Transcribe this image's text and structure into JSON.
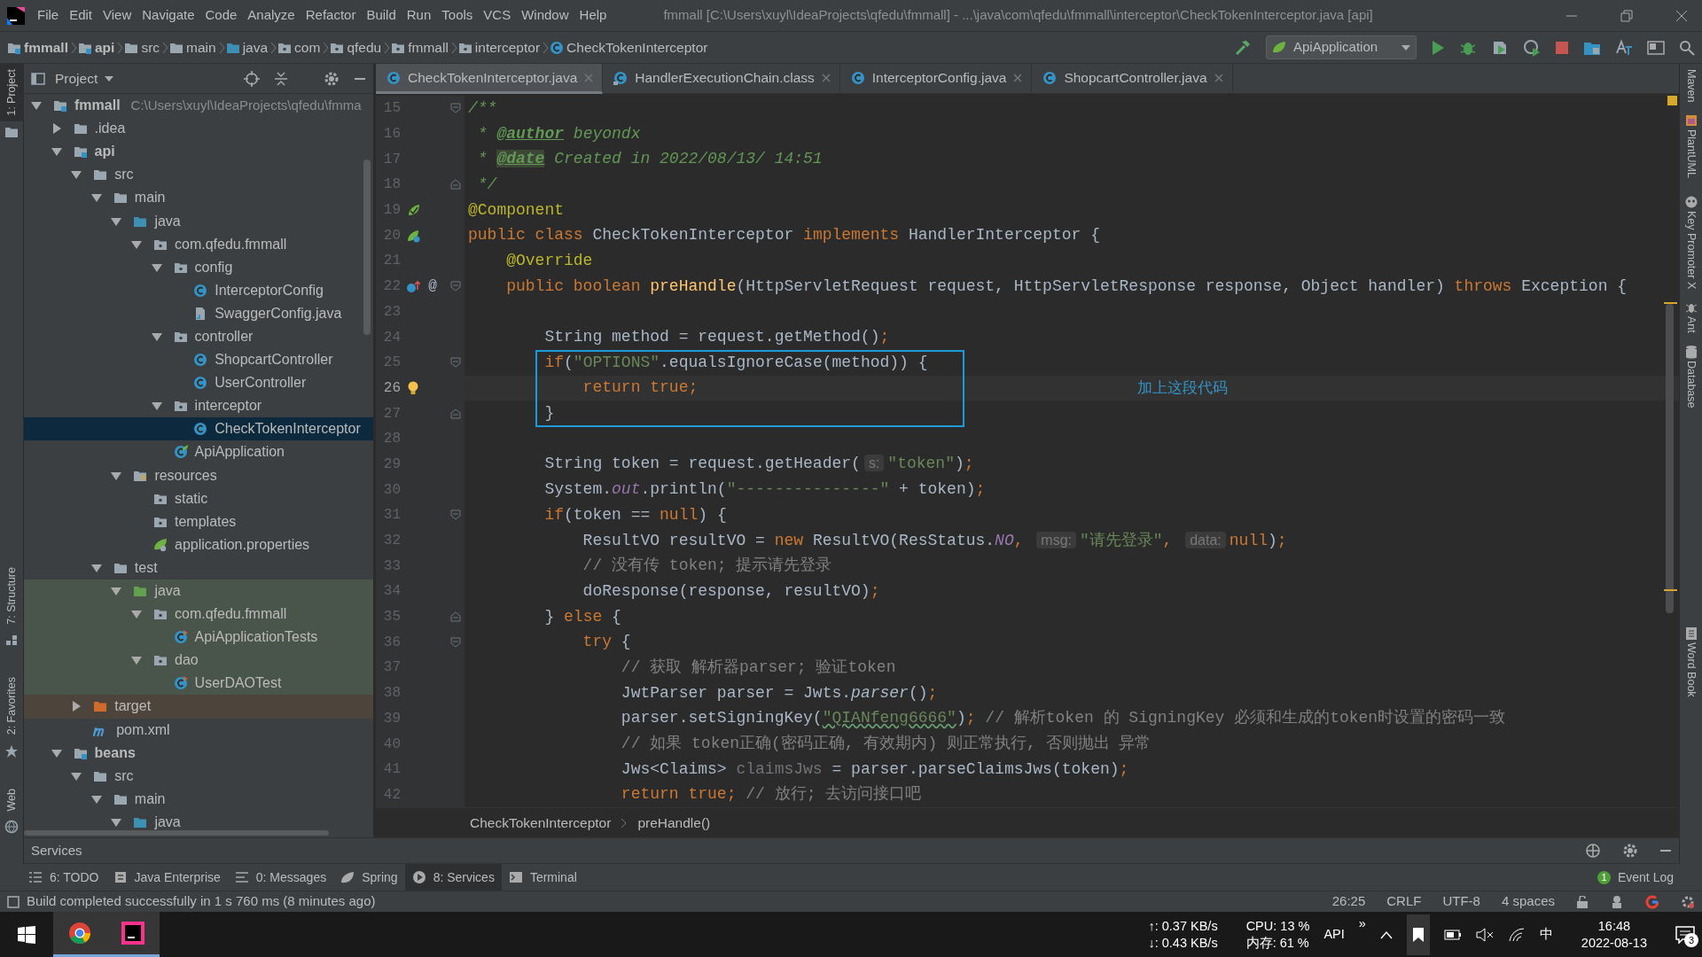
{
  "window": {
    "title": "fmmall [C:\\Users\\xuyl\\IdeaProjects\\qfedu\\fmmall] - ...\\java\\com\\qfedu\\fmmall\\interceptor\\CheckTokenInterceptor.java [api]"
  },
  "menu": [
    "File",
    "Edit",
    "View",
    "Navigate",
    "Code",
    "Analyze",
    "Refactor",
    "Build",
    "Run",
    "Tools",
    "VCS",
    "Window",
    "Help"
  ],
  "breadcrumbs": [
    {
      "label": "fmmall",
      "kind": "module"
    },
    {
      "label": "api",
      "kind": "module"
    },
    {
      "label": "src",
      "kind": "folder"
    },
    {
      "label": "main",
      "kind": "folder"
    },
    {
      "label": "java",
      "kind": "source-root"
    },
    {
      "label": "com",
      "kind": "package"
    },
    {
      "label": "qfedu",
      "kind": "package"
    },
    {
      "label": "fmmall",
      "kind": "package"
    },
    {
      "label": "interceptor",
      "kind": "package"
    },
    {
      "label": "CheckTokenInterceptor",
      "kind": "class"
    }
  ],
  "run_configuration": "ApiApplication",
  "left_strip": [
    {
      "label": "1: Project",
      "selected": true
    },
    {
      "label": "7: Structure",
      "selected": false
    },
    {
      "label": "2: Favorites",
      "selected": false
    },
    {
      "label": "Web",
      "selected": false
    }
  ],
  "right_strip": [
    "Maven",
    "PlantUML",
    "Key Promoter X",
    "Ant",
    "Database",
    "Word Book"
  ],
  "project_panel": {
    "title": "Project"
  },
  "project_tree": [
    {
      "label": "fmmall",
      "kind": "module",
      "path": "C:\\Users\\xuyl\\IdeaProjects\\qfedu\\fmma",
      "expanded": true,
      "selected": false,
      "children": [
        {
          "label": ".idea",
          "kind": "folder",
          "expanded": false,
          "selected": false
        },
        {
          "label": "api",
          "kind": "module",
          "expanded": true,
          "selected": false,
          "children": [
            {
              "label": "src",
              "kind": "folder",
              "expanded": true,
              "selected": false,
              "children": [
                {
                  "label": "main",
                  "kind": "folder",
                  "expanded": true,
                  "selected": false,
                  "children": [
                    {
                      "label": "java",
                      "kind": "source-root",
                      "expanded": true,
                      "selected": false,
                      "children": [
                        {
                          "label": "com.qfedu.fmmall",
                          "kind": "package",
                          "expanded": true,
                          "selected": false,
                          "children": [
                            {
                              "label": "config",
                              "kind": "package",
                              "expanded": true,
                              "selected": false,
                              "children": [
                                {
                                  "label": "InterceptorConfig",
                                  "kind": "class",
                                  "selected": false
                                },
                                {
                                  "label": "SwaggerConfig.java",
                                  "kind": "java-file",
                                  "selected": false
                                }
                              ]
                            },
                            {
                              "label": "controller",
                              "kind": "package",
                              "expanded": true,
                              "selected": false,
                              "children": [
                                {
                                  "label": "ShopcartController",
                                  "kind": "class",
                                  "selected": false
                                },
                                {
                                  "label": "UserController",
                                  "kind": "class",
                                  "selected": false
                                }
                              ]
                            },
                            {
                              "label": "interceptor",
                              "kind": "package",
                              "expanded": true,
                              "selected": false,
                              "children": [
                                {
                                  "label": "CheckTokenInterceptor",
                                  "kind": "class",
                                  "selected": true
                                }
                              ]
                            },
                            {
                              "label": "ApiApplication",
                              "kind": "spring-class",
                              "selected": false
                            }
                          ]
                        }
                      ]
                    },
                    {
                      "label": "resources",
                      "kind": "resources-root",
                      "expanded": true,
                      "selected": false,
                      "children": [
                        {
                          "label": "static",
                          "kind": "package",
                          "selected": false
                        },
                        {
                          "label": "templates",
                          "kind": "package",
                          "selected": false
                        },
                        {
                          "label": "application.properties",
                          "kind": "properties",
                          "selected": false
                        }
                      ]
                    }
                  ]
                },
                {
                  "label": "test",
                  "kind": "folder",
                  "expanded": true,
                  "selected": false,
                  "children": [
                    {
                      "label": "java",
                      "kind": "test-root",
                      "test_scope": true,
                      "expanded": true,
                      "selected": false,
                      "children": [
                        {
                          "label": "com.qfedu.fmmall",
                          "kind": "package",
                          "test_scope": true,
                          "expanded": true,
                          "selected": false,
                          "children": [
                            {
                              "label": "ApiApplicationTests",
                              "kind": "test-class",
                              "test_scope": true,
                              "selected": false
                            }
                          ]
                        },
                        {
                          "label": "dao",
                          "kind": "package",
                          "test_scope": true,
                          "expanded": true,
                          "selected": false,
                          "children": [
                            {
                              "label": "UserDAOTest",
                              "kind": "test-class",
                              "test_scope": true,
                              "selected": false
                            }
                          ]
                        }
                      ]
                    }
                  ]
                }
              ]
            },
            {
              "label": "target",
              "kind": "excluded-folder",
              "excluded": true,
              "expanded": false,
              "selected": false
            },
            {
              "label": "pom.xml",
              "kind": "maven",
              "selected": false
            }
          ]
        },
        {
          "label": "beans",
          "kind": "module",
          "expanded": true,
          "selected": false,
          "children": [
            {
              "label": "src",
              "kind": "folder",
              "expanded": true,
              "selected": false,
              "children": [
                {
                  "label": "main",
                  "kind": "folder",
                  "expanded": true,
                  "selected": false,
                  "children": [
                    {
                      "label": "java",
                      "kind": "source-root",
                      "expanded": true,
                      "selected": false
                    }
                  ]
                }
              ]
            }
          ]
        }
      ]
    }
  ],
  "editor_tabs": [
    {
      "label": "CheckTokenInterceptor.java",
      "kind": "class",
      "selected": true
    },
    {
      "label": "HandlerExecutionChain.class",
      "kind": "compiled-class",
      "selected": false
    },
    {
      "label": "InterceptorConfig.java",
      "kind": "class",
      "selected": false
    },
    {
      "label": "ShopcartController.java",
      "kind": "class",
      "selected": false
    }
  ],
  "code_lines": [
    {
      "number": "15",
      "fold": {
        "kind": "start"
      },
      "tokens": [
        {
          "kind": "doc",
          "text": "/**"
        }
      ]
    },
    {
      "number": "16",
      "tokens": [
        {
          "kind": "doc",
          "text": " * "
        },
        {
          "kind": "doc-tag",
          "text": "@author"
        },
        {
          "kind": "doc-italic",
          "text": " beyondx"
        }
      ]
    },
    {
      "number": "17",
      "tokens": [
        {
          "kind": "doc",
          "text": " * "
        },
        {
          "kind": "doc-tag-marked",
          "text": "@date"
        },
        {
          "kind": "doc-italic",
          "text": " Created in 2022/08/13/ 14:51"
        }
      ]
    },
    {
      "number": "18",
      "fold": {
        "kind": "end"
      },
      "tokens": [
        {
          "kind": "doc",
          "text": " */"
        }
      ]
    },
    {
      "number": "19",
      "marker": {
        "kind": "bean"
      },
      "tokens": [
        {
          "kind": "annotation",
          "text": "@Component"
        }
      ]
    },
    {
      "number": "20",
      "marker": {
        "kind": "bean-link"
      },
      "tokens": [
        {
          "kind": "keyword",
          "text": "public class "
        },
        {
          "kind": "plain",
          "text": "CheckTokenInterceptor "
        },
        {
          "kind": "keyword",
          "text": "implements "
        },
        {
          "kind": "plain",
          "text": "HandlerInterceptor {"
        }
      ]
    },
    {
      "number": "21",
      "tokens": [
        {
          "kind": "annotation",
          "text": "    @Override"
        }
      ]
    },
    {
      "number": "22",
      "marker": {
        "kind": "override"
      },
      "gutter_text": "@",
      "fold": {
        "kind": "start"
      },
      "tokens": [
        {
          "kind": "keyword",
          "text": "    public boolean "
        },
        {
          "kind": "method-decl",
          "text": "preHandle"
        },
        {
          "kind": "plain",
          "text": "(HttpServletRequest request, HttpServletResponse response, Object handler) "
        },
        {
          "kind": "keyword",
          "text": "throws "
        },
        {
          "kind": "plain",
          "text": "Exception {"
        }
      ]
    },
    {
      "number": "23"
    },
    {
      "number": "24",
      "tokens": [
        {
          "kind": "plain",
          "text": "        String method = request.getMethod()"
        },
        {
          "kind": "keyword",
          "text": ";"
        }
      ]
    },
    {
      "number": "25",
      "fold": {
        "kind": "start"
      },
      "boxed": true,
      "tokens": [
        {
          "kind": "keyword",
          "text": "        if"
        },
        {
          "kind": "plain",
          "text": "("
        },
        {
          "kind": "string",
          "text": "\"OPTIONS\""
        },
        {
          "kind": "plain",
          "text": ".equalsIgnoreCase(method)) {"
        }
      ]
    },
    {
      "number": "26",
      "marker": {
        "kind": "bulb"
      },
      "current": true,
      "boxed": true,
      "note": "加上这段代码",
      "tokens": [
        {
          "kind": "keyword",
          "text": "            return true;"
        }
      ]
    },
    {
      "number": "27",
      "fold": {
        "kind": "end"
      },
      "boxed": true,
      "tokens": [
        {
          "kind": "plain",
          "text": "        }"
        }
      ]
    },
    {
      "number": "28"
    },
    {
      "number": "29",
      "tokens": [
        {
          "kind": "plain",
          "text": "        String token = request.getHeader("
        },
        {
          "kind": "hint",
          "text": "s:"
        },
        {
          "kind": "string",
          "text": "\"token\""
        },
        {
          "kind": "plain",
          "text": ")"
        },
        {
          "kind": "keyword",
          "text": ";"
        }
      ]
    },
    {
      "number": "30",
      "tokens": [
        {
          "kind": "plain",
          "text": "        System."
        },
        {
          "kind": "static-field",
          "text": "out"
        },
        {
          "kind": "plain",
          "text": ".println("
        },
        {
          "kind": "string",
          "text": "\"---------------\""
        },
        {
          "kind": "plain",
          "text": " + token)"
        },
        {
          "kind": "keyword",
          "text": ";"
        }
      ]
    },
    {
      "number": "31",
      "fold": {
        "kind": "start"
      },
      "tokens": [
        {
          "kind": "keyword",
          "text": "        if"
        },
        {
          "kind": "plain",
          "text": "(token == "
        },
        {
          "kind": "keyword",
          "text": "null"
        },
        {
          "kind": "plain",
          "text": ") {"
        }
      ]
    },
    {
      "number": "32",
      "tokens": [
        {
          "kind": "plain",
          "text": "            ResultVO resultVO = "
        },
        {
          "kind": "keyword",
          "text": "new "
        },
        {
          "kind": "plain",
          "text": "ResultVO(ResStatus."
        },
        {
          "kind": "static-field",
          "text": "NO"
        },
        {
          "kind": "keyword",
          "text": ", "
        },
        {
          "kind": "hint",
          "text": "msg:"
        },
        {
          "kind": "string",
          "text": "\"请先登录\""
        },
        {
          "kind": "keyword",
          "text": ", "
        },
        {
          "kind": "hint",
          "text": "data:"
        },
        {
          "kind": "keyword",
          "text": "null"
        },
        {
          "kind": "plain",
          "text": ")"
        },
        {
          "kind": "keyword",
          "text": ";"
        }
      ]
    },
    {
      "number": "33",
      "tokens": [
        {
          "kind": "comment",
          "text": "            // 没有传 token; 提示请先登录"
        }
      ]
    },
    {
      "number": "34",
      "tokens": [
        {
          "kind": "plain",
          "text": "            doResponse(response, resultVO)"
        },
        {
          "kind": "keyword",
          "text": ";"
        }
      ]
    },
    {
      "number": "35",
      "fold": {
        "kind": "end"
      },
      "tokens": [
        {
          "kind": "plain",
          "text": "        } "
        },
        {
          "kind": "keyword",
          "text": "else "
        },
        {
          "kind": "plain",
          "text": "{"
        }
      ]
    },
    {
      "number": "36",
      "fold": {
        "kind": "start"
      },
      "tokens": [
        {
          "kind": "keyword",
          "text": "            try "
        },
        {
          "kind": "plain",
          "text": "{"
        }
      ]
    },
    {
      "number": "37",
      "tokens": [
        {
          "kind": "comment",
          "text": "                // 获取 解析器parser; 验证token"
        }
      ]
    },
    {
      "number": "38",
      "tokens": [
        {
          "kind": "plain",
          "text": "                JwtParser parser = Jwts."
        },
        {
          "kind": "static-method",
          "text": "parser"
        },
        {
          "kind": "plain",
          "text": "()"
        },
        {
          "kind": "keyword",
          "text": ";"
        }
      ]
    },
    {
      "number": "39",
      "tokens": [
        {
          "kind": "plain",
          "text": "                parser.setSigningKey("
        },
        {
          "kind": "string-typo",
          "text": "\"QIANfeng6666\""
        },
        {
          "kind": "plain",
          "text": ")"
        },
        {
          "kind": "keyword",
          "text": "; "
        },
        {
          "kind": "comment",
          "text": "// 解析token 的 SigningKey 必须和生成的token时设置的密码一致"
        }
      ]
    },
    {
      "number": "40",
      "tokens": [
        {
          "kind": "comment",
          "text": "                // 如果 token正确(密码正确, 有效期内) 则正常执行, 否则抛出 异常"
        }
      ]
    },
    {
      "number": "41",
      "tokens": [
        {
          "kind": "plain",
          "text": "                Jws<Claims> "
        },
        {
          "kind": "unused",
          "text": "claimsJws "
        },
        {
          "kind": "plain",
          "text": "= parser.parseClaimsJws(token)"
        },
        {
          "kind": "keyword",
          "text": ";"
        }
      ]
    },
    {
      "number": "42",
      "tokens": [
        {
          "kind": "keyword",
          "text": "                return true; "
        },
        {
          "kind": "comment",
          "text": "// 放行; 去访问接口吧"
        }
      ]
    }
  ],
  "editor_breadcrumbs": [
    "CheckTokenInterceptor",
    "preHandle()"
  ],
  "services_panel": {
    "title": "Services"
  },
  "tool_tabs": [
    {
      "label": "6: TODO",
      "kind": "todo",
      "selected": false
    },
    {
      "label": "Java Enterprise",
      "kind": "enterprise",
      "selected": false
    },
    {
      "label": "0: Messages",
      "kind": "messages",
      "selected": false
    },
    {
      "label": "Spring",
      "kind": "spring",
      "selected": false
    },
    {
      "label": "8: Services",
      "kind": "services",
      "selected": true
    },
    {
      "label": "Terminal",
      "kind": "terminal",
      "selected": false
    }
  ],
  "event_log": {
    "label": "Event Log",
    "count": "1"
  },
  "status_bar": {
    "message": "Build completed successfully in 1 s 760 ms (8 minutes ago)",
    "position": "26:25",
    "line_separator": "CRLF",
    "encoding": "UTF-8",
    "indent": "4 spaces"
  },
  "taskbar": {
    "upload": "↑: 0.37 KB/s",
    "download": "↓: 0.43 KB/s",
    "cpu": "CPU: 13 %",
    "memory": "内存: 61 %",
    "app_label": "API",
    "overflow": "»",
    "input_method": "中",
    "time": "16:48",
    "date": "2022-08-13",
    "notifications": "3"
  }
}
